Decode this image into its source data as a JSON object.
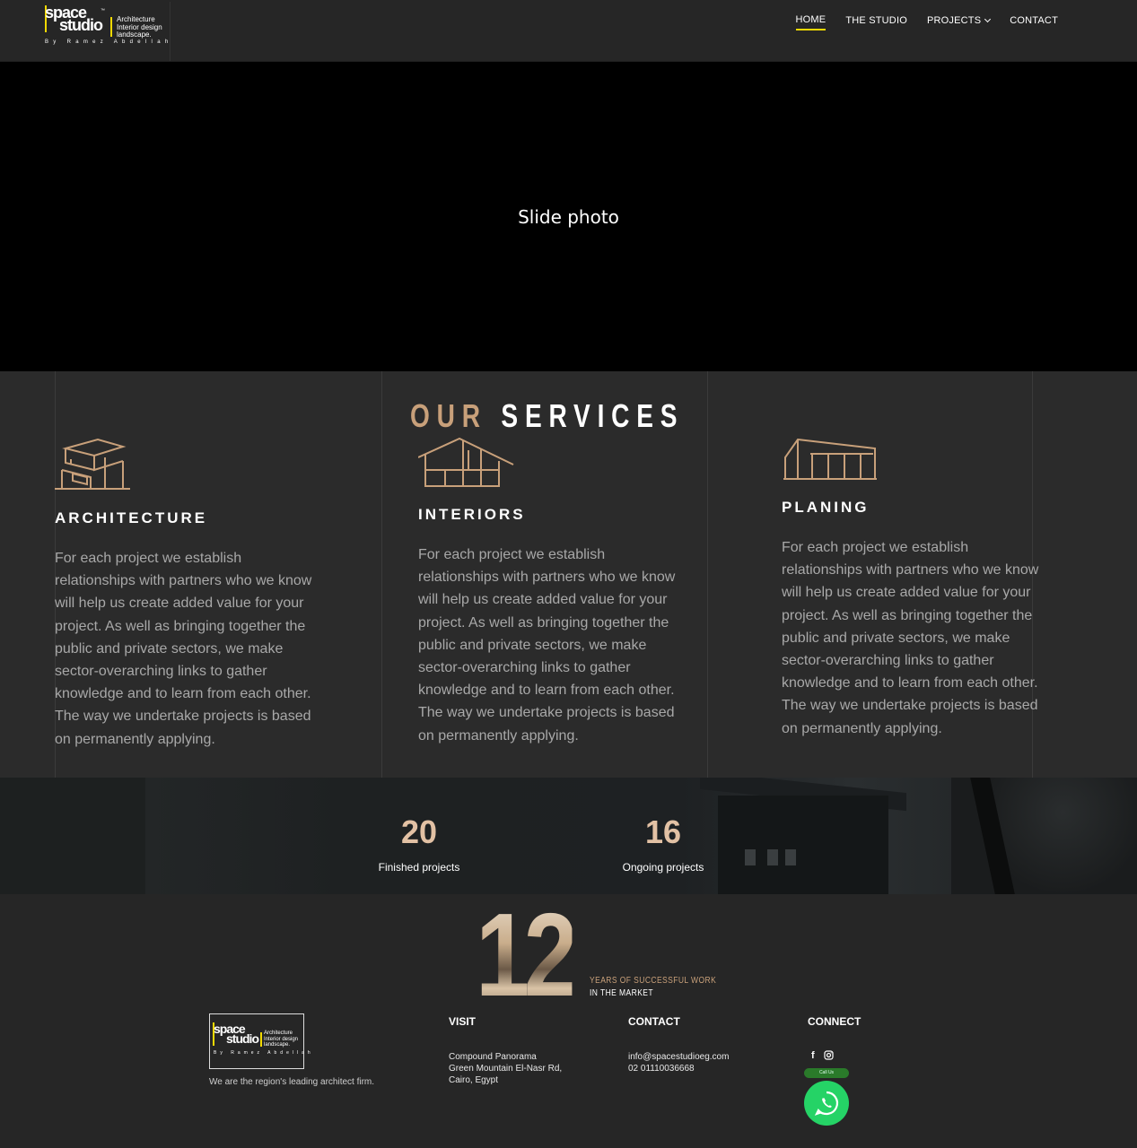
{
  "header": {
    "logo": {
      "line1": "space",
      "line2": "studio",
      "tm": "™",
      "sub1": "Architecture",
      "sub2": "Interior design",
      "sub3": "landscape.",
      "by": "By Ramez Abdellah"
    },
    "nav": [
      {
        "label": "HOME",
        "active": true
      },
      {
        "label": "THE STUDIO",
        "active": false
      },
      {
        "label": "PROJECTS",
        "active": false,
        "dropdown": true
      },
      {
        "label": "CONTACT",
        "active": false
      }
    ]
  },
  "hero": {
    "text": "Slide photo"
  },
  "services": {
    "title_part1": "OUR",
    "title_part2": "SERVICES",
    "items": [
      {
        "title": "ARCHITECTURE",
        "icon": "architecture-icon",
        "text": "For each project we establish relationships with partners who we know will help us create added value for your project. As well as bringing together the public and private sectors, we make sector-overarching links to gather knowledge and to learn from each other. The way we undertake projects is based on permanently applying."
      },
      {
        "title": "INTERIORS",
        "icon": "interiors-icon",
        "text": "For each project we establish relationships with partners who we know will help us create added value for your project. As well as bringing together the public and private sectors, we make sector-overarching links to gather knowledge and to learn from each other. The way we undertake projects is based on permanently applying."
      },
      {
        "title": "PLANING",
        "icon": "planing-icon",
        "text": "For each project we establish relationships with partners who we know will help us create added value for your project. As well as bringing together the public and private sectors, we make sector-overarching links to gather knowledge and to learn from each other. The way we undertake projects is based on permanently applying."
      }
    ]
  },
  "counters": [
    {
      "value": "20",
      "label": "Finished projects"
    },
    {
      "value": "16",
      "label": "Ongoing projects"
    }
  ],
  "years": {
    "number": "12",
    "line1": "YEARS OF SUCCESSFUL WORK",
    "line2": "IN THE MARKET"
  },
  "footer": {
    "tagline": "We are the region's leading architect firm.",
    "visit": {
      "heading": "VISIT",
      "lines": [
        "Compound Panorama",
        "Green Mountain El-Nasr Rd,",
        "Cairo, Egypt"
      ]
    },
    "contact": {
      "heading": "CONTACT",
      "email": "info@spacestudioeg.com",
      "phone": "02 01110036668"
    },
    "connect": {
      "heading": "CONNECT",
      "icons": [
        "facebook-icon",
        "instagram-icon"
      ],
      "chat_label": "Call Us"
    }
  },
  "colors": {
    "accent_gold": "#c8a07a",
    "nav_underline": "#f2d900",
    "whatsapp": "#25d366"
  }
}
